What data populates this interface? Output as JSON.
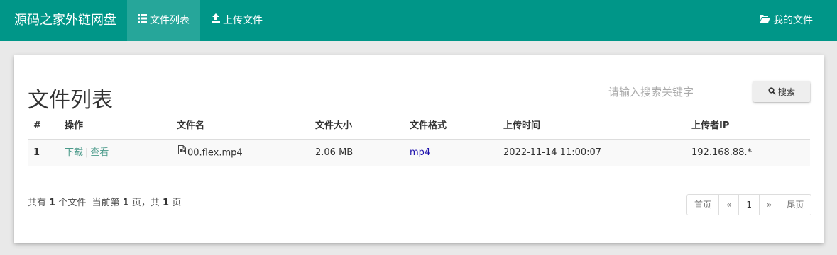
{
  "nav": {
    "brand": "源码之家外链网盘",
    "items": [
      {
        "label": "文件列表",
        "icon": "list-icon"
      },
      {
        "label": "上传文件",
        "icon": "upload-icon"
      }
    ],
    "right_item": {
      "label": "我的文件",
      "icon": "folder-open-icon"
    }
  },
  "colors": {
    "primary": "#009688",
    "active_nav": "#26a69a",
    "link_green": "#4a9a8a",
    "link_blue": "#1a0dab"
  },
  "main": {
    "title": "文件列表",
    "search": {
      "placeholder": "请输入搜索关键字",
      "value": "",
      "button_label": "搜索",
      "button_icon": "search-icon"
    },
    "table": {
      "headers": [
        "#",
        "操作",
        "文件名",
        "文件大小",
        "文件格式",
        "上传时间",
        "上传者IP"
      ],
      "rows": [
        {
          "index": "1",
          "actions": [
            "下载",
            "查看"
          ],
          "action_separator": "|",
          "filename": "00.flex.mp4",
          "file_icon": "file-video-icon",
          "size": "2.06 MB",
          "format": "mp4",
          "upload_time": "2022-11-14 11:00:07",
          "uploader_ip": "192.168.88.*"
        }
      ]
    },
    "summary": {
      "prefix": "共有",
      "count": "1",
      "files_text": "个文件",
      "current_prefix": "当前第",
      "current_page": "1",
      "page_unit": "页，",
      "total_prefix": "共",
      "total_pages": "1",
      "total_unit": "页"
    },
    "pagination": {
      "first": "首页",
      "prev": "«",
      "current": "1",
      "next": "»",
      "last": "尾页"
    }
  }
}
